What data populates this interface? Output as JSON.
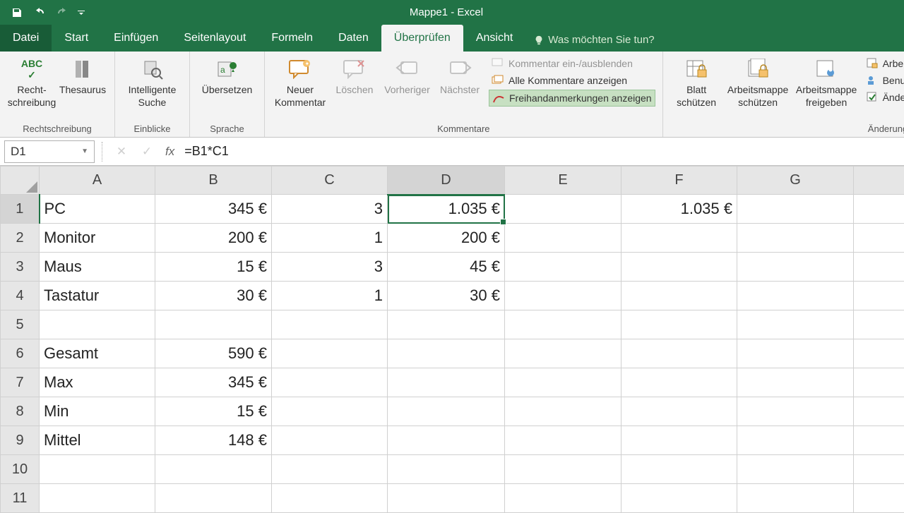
{
  "app_title": "Mappe1 - Excel",
  "tabs": {
    "file": "Datei",
    "home": "Start",
    "insert": "Einfügen",
    "page_layout": "Seitenlayout",
    "formulas": "Formeln",
    "data": "Daten",
    "review": "Überprüfen",
    "view": "Ansicht",
    "tell_me": "Was möchten Sie tun?"
  },
  "ribbon": {
    "proofing": {
      "spell": "Recht-\nschreibung",
      "thesaurus": "Thesaurus",
      "group": "Rechtschreibung"
    },
    "insights": {
      "smart_lookup": "Intelligente\nSuche",
      "group": "Einblicke"
    },
    "language": {
      "translate": "Übersetzen",
      "group": "Sprache"
    },
    "comments": {
      "new": "Neuer\nKommentar",
      "delete": "Löschen",
      "prev": "Vorheriger",
      "next": "Nächster",
      "toggle": "Kommentar ein-/ausblenden",
      "show_all": "Alle Kommentare anzeigen",
      "ink": "Freihandanmerkungen anzeigen",
      "group": "Kommentare"
    },
    "protect": {
      "sheet": "Blatt\nschützen",
      "workbook": "Arbeitsmappe\nschützen",
      "share": "Arbeitsmappe\nfreigeben"
    },
    "changes": {
      "share_protect": "Arbeitsm",
      "allow_users": "Benutzer",
      "track": "Änderu",
      "group": "Änderungen"
    }
  },
  "name_box": "D1",
  "formula": "=B1*C1",
  "columns": [
    "A",
    "B",
    "C",
    "D",
    "E",
    "F",
    "G"
  ],
  "rows": [
    {
      "n": "1",
      "A": "PC",
      "B": "345 €",
      "C": "3",
      "D": "1.035 €",
      "F": "1.035 €"
    },
    {
      "n": "2",
      "A": "Monitor",
      "B": "200 €",
      "C": "1",
      "D": "200 €"
    },
    {
      "n": "3",
      "A": "Maus",
      "B": "15 €",
      "C": "3",
      "D": "45 €"
    },
    {
      "n": "4",
      "A": "Tastatur",
      "B": "30 €",
      "C": "1",
      "D": "30 €"
    },
    {
      "n": "5"
    },
    {
      "n": "6",
      "A": "Gesamt",
      "B": "590 €"
    },
    {
      "n": "7",
      "A": "Max",
      "B": "345 €"
    },
    {
      "n": "8",
      "A": "Min",
      "B": "15 €"
    },
    {
      "n": "9",
      "A": "Mittel",
      "B": "148 €"
    },
    {
      "n": "10"
    },
    {
      "n": "11"
    }
  ],
  "selected": {
    "col": "D",
    "row": "1"
  }
}
